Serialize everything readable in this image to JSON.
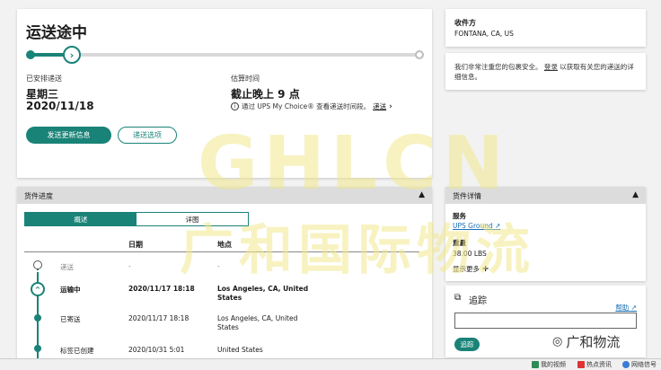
{
  "status": {
    "title": "运送途中",
    "progress": 0.12,
    "scheduled_label": "已安排递送",
    "scheduled_day": "星期三",
    "scheduled_date": "2020/11/18",
    "estimate_label": "估算时间",
    "estimate_value": "截止晚上 9 点",
    "estimate_note": "通过 UPS My Choice® 查看递送时间段。",
    "estimate_link": "递送",
    "alert_button": "发送更新信息",
    "options_button": "递送选项"
  },
  "recipient": {
    "label": "收件方",
    "value": "FONTANA, CA, US"
  },
  "security": {
    "text_before": "我们非常注重您的包裹安全。",
    "login_link": "登录",
    "text_after": "以获取有关您的递送的详细信息。"
  },
  "progress_panel": {
    "title": "货件进度",
    "tabs": {
      "overview": "概述",
      "detail": "详图"
    },
    "columns": {
      "date": "日期",
      "location": "地点"
    },
    "rows": [
      {
        "status": "递送",
        "date": "-",
        "location": "-"
      },
      {
        "status": "运输中",
        "date": "2020/11/17  18:18",
        "location": "Los Angeles, CA, United States"
      },
      {
        "status": "已寄送",
        "date": "2020/11/17  18:18",
        "location": "Los Angeles, CA, United States"
      },
      {
        "status": "标签已创建",
        "date": "2020/10/31  5:01",
        "location": "United States"
      }
    ]
  },
  "detail_panel": {
    "title": "货件详情",
    "service_label": "服务",
    "service_value": "UPS Ground",
    "weight_label": "重量",
    "weight_value": "38.00 LBS",
    "more_link": "显示更多"
  },
  "track": {
    "title": "追踪",
    "help": "帮助",
    "input_value": "",
    "button": "追踪"
  },
  "watermark": {
    "top": "GHLCN",
    "bottom": "广和国际物流"
  },
  "wechat_tag": "广和物流",
  "bottom_bar": {
    "video": "我的视频",
    "news": "热点资讯",
    "net": "网络信号"
  },
  "colors": {
    "accent": "#1a8378",
    "link": "#1a6fb3",
    "watermark": "#f0e88c"
  }
}
